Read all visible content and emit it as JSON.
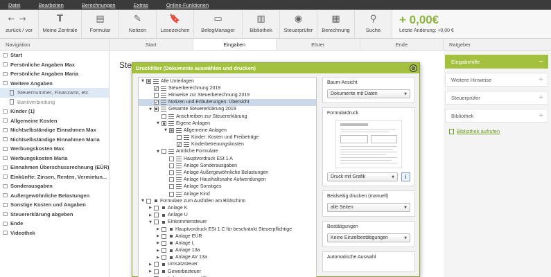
{
  "menu": [
    "Datei",
    "Bearbeiten",
    "Berechnungen",
    "Extras",
    "Online-Funktionen"
  ],
  "toolbar": {
    "nav_label": "zurück / vor",
    "items": [
      {
        "label": "Meine Zentrale",
        "icon": "T"
      },
      {
        "label": "Formular",
        "icon": "▤"
      },
      {
        "label": "Notizen",
        "icon": "✎"
      },
      {
        "label": "Lesezeichen",
        "icon": "🔖"
      },
      {
        "label": "BelegManager",
        "icon": "▭"
      },
      {
        "label": "Bibliothek",
        "icon": "▥"
      },
      {
        "label": "Steuerprüfer",
        "icon": "◉"
      },
      {
        "label": "Berechnung",
        "icon": "▦"
      },
      {
        "label": "Suche",
        "icon": "⚲"
      }
    ],
    "balance_amount": "+ 0,00€",
    "balance_change": "Letzte Änderung: +0,00 €"
  },
  "navigation_header": "Navigation",
  "tabs": [
    "Start",
    "Eingaben",
    "Elster",
    "Ende"
  ],
  "active_tab": 1,
  "ratgeber_header": "Ratgeber",
  "content_title": "Steue",
  "nav": [
    {
      "label": "Start",
      "type": "item"
    },
    {
      "label": "Persönliche Angaben Max",
      "type": "item"
    },
    {
      "label": "Persönliche Angaben Maria",
      "type": "item"
    },
    {
      "label": "Weitere Angaben",
      "type": "item"
    },
    {
      "label": "Steuernummer, Finanzamt, etc.",
      "type": "sub",
      "selected": true
    },
    {
      "label": "Bankverbindung",
      "type": "sub",
      "grey": true
    },
    {
      "label": "Kinder (1)",
      "type": "item"
    },
    {
      "label": "Allgemeine Kosten",
      "type": "item"
    },
    {
      "label": "Nichtselbständige Einnahmen Max",
      "type": "item"
    },
    {
      "label": "Nichtselbständige Einnahmen Maria",
      "type": "item"
    },
    {
      "label": "Werbungskosten Max",
      "type": "item"
    },
    {
      "label": "Werbungskosten Maria",
      "type": "item"
    },
    {
      "label": "Einnahmen Überschussrechnung (EÜR)",
      "type": "item"
    },
    {
      "label": "Einkünfte: Zinsen, Renten, Vermietun...",
      "type": "item"
    },
    {
      "label": "Sonderausgaben",
      "type": "item"
    },
    {
      "label": "Außergewöhnliche Belastungen",
      "type": "item"
    },
    {
      "label": "Sonstige Kosten und Angaben",
      "type": "item"
    },
    {
      "label": "Steuererklärung abgeben",
      "type": "item"
    },
    {
      "label": "Ende",
      "type": "item"
    },
    {
      "label": "Videothek",
      "type": "item"
    }
  ],
  "ratgeber": [
    {
      "label": "Eingabehilfe",
      "active": true,
      "sign": "−"
    },
    {
      "label": "Weitere Hinweise",
      "sign": "+"
    },
    {
      "label": "Steuerprüfer",
      "sign": "+"
    },
    {
      "label": "Bibliothek",
      "sign": "+"
    }
  ],
  "ratgeber_link": "Bibliothek aufrufen",
  "dialog": {
    "title": "Druckfilter (Dokumente auswählen und drucken)",
    "close_icon": "⊗",
    "tree": [
      {
        "indent": 0,
        "toggle": "▼",
        "check": "partial",
        "icon": "doc",
        "label": "Alle Unterlagen"
      },
      {
        "indent": 1,
        "toggle": "",
        "check": "checked",
        "icon": "doc",
        "label": "Steuerberechnung 2019"
      },
      {
        "indent": 1,
        "toggle": "",
        "check": "",
        "icon": "doc",
        "label": "Hinweise zur Steuerberechnung 2019"
      },
      {
        "indent": 1,
        "toggle": "",
        "check": "checked",
        "icon": "doc",
        "label": "Notizen und Erläuterungen: Übersicht",
        "selected": true
      },
      {
        "indent": 1,
        "toggle": "▼",
        "check": "partial",
        "icon": "doc",
        "label": "Gesamte Steuererklärung 2019"
      },
      {
        "indent": 2,
        "toggle": "",
        "check": "",
        "icon": "doc",
        "label": "Anschreiben zur Steuererklärung"
      },
      {
        "indent": 2,
        "toggle": "▼",
        "check": "partial",
        "icon": "doc",
        "label": "Eigene Anlagen"
      },
      {
        "indent": 3,
        "toggle": "▼",
        "check": "partial",
        "icon": "doc",
        "label": "Allgemeine Anlagen"
      },
      {
        "indent": 4,
        "toggle": "",
        "check": "",
        "icon": "doc",
        "label": "Kinder: Kosten und Freibeträge"
      },
      {
        "indent": 4,
        "toggle": "",
        "check": "checked",
        "icon": "doc",
        "label": "Kinderbetreuungskosten"
      },
      {
        "indent": 2,
        "toggle": "▼",
        "check": "",
        "icon": "doc",
        "label": "Amtliche Formulare"
      },
      {
        "indent": 3,
        "toggle": "",
        "check": "",
        "icon": "doc",
        "label": "Hauptvordruck ESt 1 A"
      },
      {
        "indent": 3,
        "toggle": "",
        "check": "",
        "icon": "doc",
        "label": "Anlage Sonderausgaben"
      },
      {
        "indent": 3,
        "toggle": "",
        "check": "",
        "icon": "doc",
        "label": "Anlage Außergewöhnliche Belastungen"
      },
      {
        "indent": 3,
        "toggle": "",
        "check": "",
        "icon": "doc",
        "label": "Anlage Haushaltsnahe Aufwendungen"
      },
      {
        "indent": 3,
        "toggle": "",
        "check": "",
        "icon": "doc",
        "label": "Anlage Sonstiges"
      },
      {
        "indent": 3,
        "toggle": "",
        "check": "",
        "icon": "doc",
        "label": "Anlage Kind"
      },
      {
        "indent": 0,
        "toggle": "▼",
        "check": "",
        "icon": "bullet",
        "label": "Formulare zum Ausfüllen am Bildschirm"
      },
      {
        "indent": 1,
        "toggle": "▶",
        "check": "",
        "icon": "bullet",
        "label": "Anlage K"
      },
      {
        "indent": 1,
        "toggle": "▶",
        "check": "",
        "icon": "bullet",
        "label": "Anlage U"
      },
      {
        "indent": 1,
        "toggle": "▼",
        "check": "",
        "icon": "bullet",
        "label": "Einkommensteuer"
      },
      {
        "indent": 2,
        "toggle": "▶",
        "check": "",
        "icon": "bullet",
        "label": "Hauptvordruck ESt 1 C für beschränkt Steuerpflichtige"
      },
      {
        "indent": 2,
        "toggle": "▶",
        "check": "",
        "icon": "bullet",
        "label": "Anlage EÜR"
      },
      {
        "indent": 2,
        "toggle": "▶",
        "check": "",
        "icon": "bullet",
        "label": "Anlage L"
      },
      {
        "indent": 2,
        "toggle": "▶",
        "check": "",
        "icon": "bullet",
        "label": "Anlage 13a"
      },
      {
        "indent": 2,
        "toggle": "▶",
        "check": "",
        "icon": "bullet",
        "label": "Anlage AV 13a"
      },
      {
        "indent": 1,
        "toggle": "▶",
        "check": "",
        "icon": "bullet",
        "label": "Umsatzsteuer"
      },
      {
        "indent": 1,
        "toggle": "▶",
        "check": "",
        "icon": "bullet",
        "label": "Gewerbesteuer"
      },
      {
        "indent": 1,
        "toggle": "▶",
        "check": "",
        "icon": "bullet",
        "label": "Lohnsteuerermäßigung"
      }
    ],
    "baum_label": "Baum-Ansicht",
    "baum_value": "Dokumente mit Daten",
    "formulardruck_label": "Formulardruck",
    "formulardruck_value": "Druck mit Grafik",
    "info_icon": "i",
    "beidseitig_label": "Beidseitig drucken (manuell)",
    "beidseitig_value": "alle Seiten",
    "bestaetigungen_label": "Bestätigungen",
    "bestaetigungen_value": "Keine Einzelbestätigungen",
    "auto_label": "Automatische Auswahl"
  },
  "colors": {
    "accent": "#a3c13e",
    "balance": "#8db43a",
    "menubar": "#3b3b3b"
  }
}
